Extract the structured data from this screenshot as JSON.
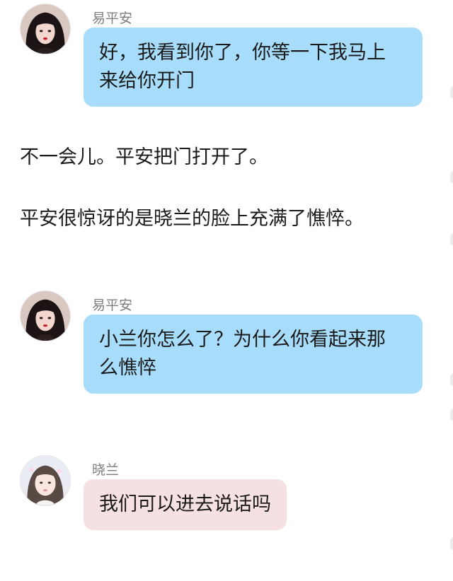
{
  "messages": [
    {
      "speaker": "易平安",
      "line1": "好，我看到你了，你等一下我马上",
      "line2": "来给你开门"
    },
    {
      "speaker": "易平安",
      "line1": "小兰你怎么了？为什么你看起来那",
      "line2": "么憔悴"
    },
    {
      "speaker": "晓兰",
      "text": "我们可以进去说话吗"
    }
  ],
  "narration": [
    "不一会儿。平安把门打开了。",
    "平安很惊讶的是晓兰的脸上充满了憔悴。"
  ],
  "colors": {
    "bubble_blue": "#a7dcfb",
    "bubble_pink": "#f5e1e1",
    "name_gray": "#7d7d7d",
    "text": "#1a1a1a"
  }
}
